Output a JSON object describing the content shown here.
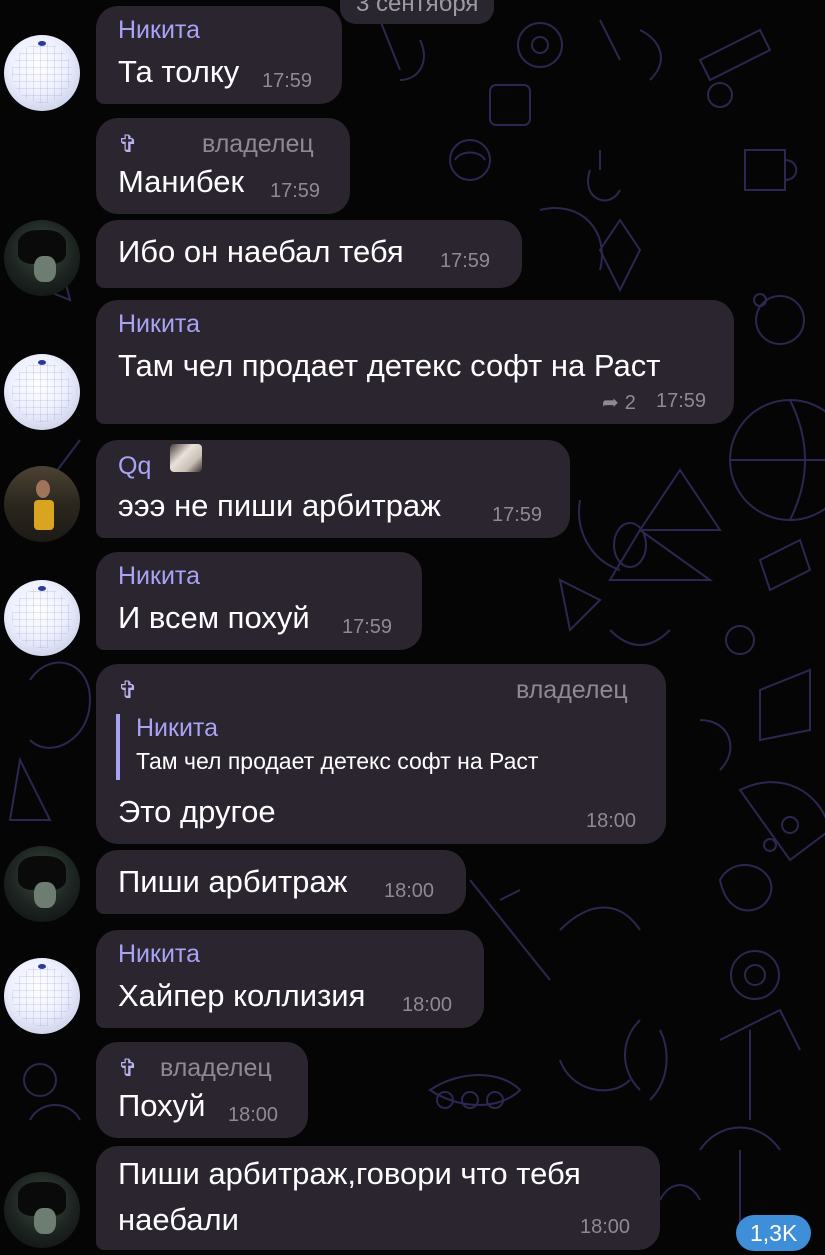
{
  "chat": {
    "date_separator": "3 сентября",
    "unread_count": "1,3K"
  },
  "messages": [
    {
      "sender": "Никита",
      "text": "Та толку",
      "time": "17:59"
    },
    {
      "cross": "✞",
      "badge": "владелец",
      "text": "Манибек",
      "time": "17:59"
    },
    {
      "text": "Ибо он наебал тебя",
      "time": "17:59"
    },
    {
      "sender": "Никита",
      "text": "Там чел продает детекс софт на Раст",
      "replies": "2",
      "time": "17:59"
    },
    {
      "sender": "Qq",
      "text": "эээ не пиши арбитраж",
      "time": "17:59"
    },
    {
      "sender": "Никита",
      "text": "И всем похуй",
      "time": "17:59"
    },
    {
      "cross": "✞",
      "badge": "владелец",
      "quote_sender": "Никита",
      "quote_text": "Там чел продает детекс софт на Раст",
      "text": "Это другое",
      "time": "18:00"
    },
    {
      "text": "Пиши арбитраж",
      "time": "18:00"
    },
    {
      "sender": "Никита",
      "text": "Хайпер коллизия",
      "time": "18:00"
    },
    {
      "cross": "✞",
      "badge": "владелец",
      "text": "Похуй",
      "time": "18:00"
    },
    {
      "text_line1": "Пиши арбитраж,говори что тебя",
      "text_line2": "наебали",
      "time": "18:00"
    }
  ],
  "icons": {
    "reply": "reply-arrow-icon",
    "owner_mark": "cross-icon"
  },
  "colors": {
    "background": "#050505",
    "bubble": "#2b2530",
    "sender_name": "#a8a3f5",
    "timestamp": "#8e8a93",
    "unread_badge": "#3e8ed8"
  }
}
